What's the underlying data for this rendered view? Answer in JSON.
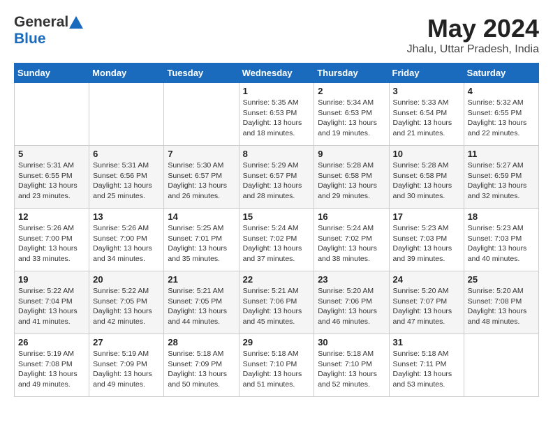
{
  "logo": {
    "line1": "General",
    "line2": "Blue"
  },
  "title": "May 2024",
  "location": "Jhalu, Uttar Pradesh, India",
  "weekdays": [
    "Sunday",
    "Monday",
    "Tuesday",
    "Wednesday",
    "Thursday",
    "Friday",
    "Saturday"
  ],
  "weeks": [
    [
      {
        "day": "",
        "info": ""
      },
      {
        "day": "",
        "info": ""
      },
      {
        "day": "",
        "info": ""
      },
      {
        "day": "1",
        "info": "Sunrise: 5:35 AM\nSunset: 6:53 PM\nDaylight: 13 hours\nand 18 minutes."
      },
      {
        "day": "2",
        "info": "Sunrise: 5:34 AM\nSunset: 6:53 PM\nDaylight: 13 hours\nand 19 minutes."
      },
      {
        "day": "3",
        "info": "Sunrise: 5:33 AM\nSunset: 6:54 PM\nDaylight: 13 hours\nand 21 minutes."
      },
      {
        "day": "4",
        "info": "Sunrise: 5:32 AM\nSunset: 6:55 PM\nDaylight: 13 hours\nand 22 minutes."
      }
    ],
    [
      {
        "day": "5",
        "info": "Sunrise: 5:31 AM\nSunset: 6:55 PM\nDaylight: 13 hours\nand 23 minutes."
      },
      {
        "day": "6",
        "info": "Sunrise: 5:31 AM\nSunset: 6:56 PM\nDaylight: 13 hours\nand 25 minutes."
      },
      {
        "day": "7",
        "info": "Sunrise: 5:30 AM\nSunset: 6:57 PM\nDaylight: 13 hours\nand 26 minutes."
      },
      {
        "day": "8",
        "info": "Sunrise: 5:29 AM\nSunset: 6:57 PM\nDaylight: 13 hours\nand 28 minutes."
      },
      {
        "day": "9",
        "info": "Sunrise: 5:28 AM\nSunset: 6:58 PM\nDaylight: 13 hours\nand 29 minutes."
      },
      {
        "day": "10",
        "info": "Sunrise: 5:28 AM\nSunset: 6:58 PM\nDaylight: 13 hours\nand 30 minutes."
      },
      {
        "day": "11",
        "info": "Sunrise: 5:27 AM\nSunset: 6:59 PM\nDaylight: 13 hours\nand 32 minutes."
      }
    ],
    [
      {
        "day": "12",
        "info": "Sunrise: 5:26 AM\nSunset: 7:00 PM\nDaylight: 13 hours\nand 33 minutes."
      },
      {
        "day": "13",
        "info": "Sunrise: 5:26 AM\nSunset: 7:00 PM\nDaylight: 13 hours\nand 34 minutes."
      },
      {
        "day": "14",
        "info": "Sunrise: 5:25 AM\nSunset: 7:01 PM\nDaylight: 13 hours\nand 35 minutes."
      },
      {
        "day": "15",
        "info": "Sunrise: 5:24 AM\nSunset: 7:02 PM\nDaylight: 13 hours\nand 37 minutes."
      },
      {
        "day": "16",
        "info": "Sunrise: 5:24 AM\nSunset: 7:02 PM\nDaylight: 13 hours\nand 38 minutes."
      },
      {
        "day": "17",
        "info": "Sunrise: 5:23 AM\nSunset: 7:03 PM\nDaylight: 13 hours\nand 39 minutes."
      },
      {
        "day": "18",
        "info": "Sunrise: 5:23 AM\nSunset: 7:03 PM\nDaylight: 13 hours\nand 40 minutes."
      }
    ],
    [
      {
        "day": "19",
        "info": "Sunrise: 5:22 AM\nSunset: 7:04 PM\nDaylight: 13 hours\nand 41 minutes."
      },
      {
        "day": "20",
        "info": "Sunrise: 5:22 AM\nSunset: 7:05 PM\nDaylight: 13 hours\nand 42 minutes."
      },
      {
        "day": "21",
        "info": "Sunrise: 5:21 AM\nSunset: 7:05 PM\nDaylight: 13 hours\nand 44 minutes."
      },
      {
        "day": "22",
        "info": "Sunrise: 5:21 AM\nSunset: 7:06 PM\nDaylight: 13 hours\nand 45 minutes."
      },
      {
        "day": "23",
        "info": "Sunrise: 5:20 AM\nSunset: 7:06 PM\nDaylight: 13 hours\nand 46 minutes."
      },
      {
        "day": "24",
        "info": "Sunrise: 5:20 AM\nSunset: 7:07 PM\nDaylight: 13 hours\nand 47 minutes."
      },
      {
        "day": "25",
        "info": "Sunrise: 5:20 AM\nSunset: 7:08 PM\nDaylight: 13 hours\nand 48 minutes."
      }
    ],
    [
      {
        "day": "26",
        "info": "Sunrise: 5:19 AM\nSunset: 7:08 PM\nDaylight: 13 hours\nand 49 minutes."
      },
      {
        "day": "27",
        "info": "Sunrise: 5:19 AM\nSunset: 7:09 PM\nDaylight: 13 hours\nand 49 minutes."
      },
      {
        "day": "28",
        "info": "Sunrise: 5:18 AM\nSunset: 7:09 PM\nDaylight: 13 hours\nand 50 minutes."
      },
      {
        "day": "29",
        "info": "Sunrise: 5:18 AM\nSunset: 7:10 PM\nDaylight: 13 hours\nand 51 minutes."
      },
      {
        "day": "30",
        "info": "Sunrise: 5:18 AM\nSunset: 7:10 PM\nDaylight: 13 hours\nand 52 minutes."
      },
      {
        "day": "31",
        "info": "Sunrise: 5:18 AM\nSunset: 7:11 PM\nDaylight: 13 hours\nand 53 minutes."
      },
      {
        "day": "",
        "info": ""
      }
    ]
  ]
}
